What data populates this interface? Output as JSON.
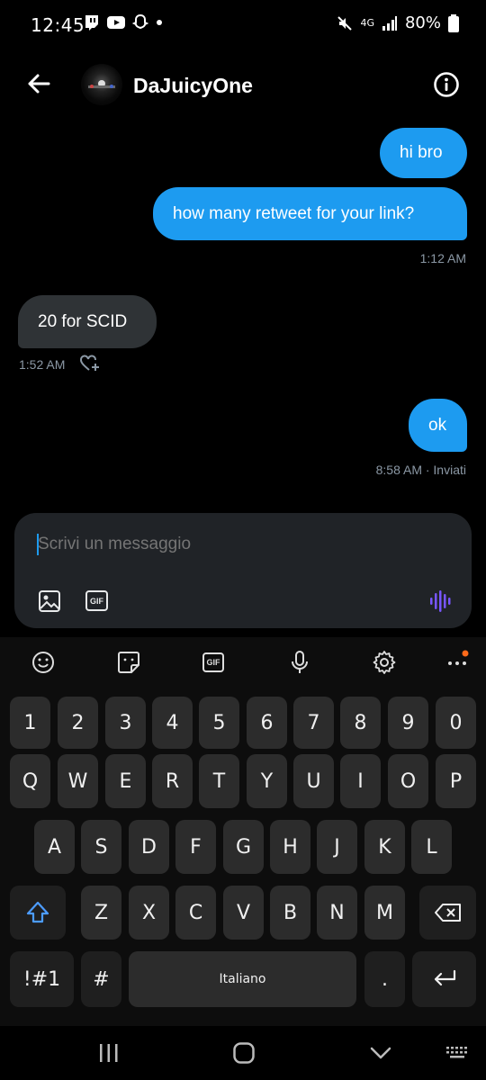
{
  "status_bar": {
    "time": "12:45",
    "network": "4G",
    "battery": "80%"
  },
  "header": {
    "username": "DaJuicyOne"
  },
  "messages": [
    {
      "text": "hi bro",
      "direction": "outgoing"
    },
    {
      "text": "how many retweet for your link?",
      "direction": "outgoing",
      "time": "1:12 AM"
    },
    {
      "text": "20 for SCID",
      "direction": "incoming",
      "time": "1:52 AM"
    },
    {
      "text": "ok",
      "direction": "outgoing",
      "time": "8:58 AM · Inviati"
    }
  ],
  "composer": {
    "placeholder": "Scrivi un messaggio",
    "gif_label": "GIF"
  },
  "keyboard": {
    "toolbar_gif_label": "GIF",
    "number_row": [
      "1",
      "2",
      "3",
      "4",
      "5",
      "6",
      "7",
      "8",
      "9",
      "0"
    ],
    "row1": [
      "Q",
      "W",
      "E",
      "R",
      "T",
      "Y",
      "U",
      "I",
      "O",
      "P"
    ],
    "row2": [
      "A",
      "S",
      "D",
      "F",
      "G",
      "H",
      "J",
      "K",
      "L"
    ],
    "row3": [
      "Z",
      "X",
      "C",
      "V",
      "B",
      "N",
      "M"
    ],
    "symbols_label": "!#1",
    "hash_label": "#",
    "space_label": "Italiano",
    "period_label": "."
  },
  "colors": {
    "accent": "#1d9bf0",
    "incoming_bubble": "#2f3336",
    "voice_icon": "#7856ff"
  }
}
